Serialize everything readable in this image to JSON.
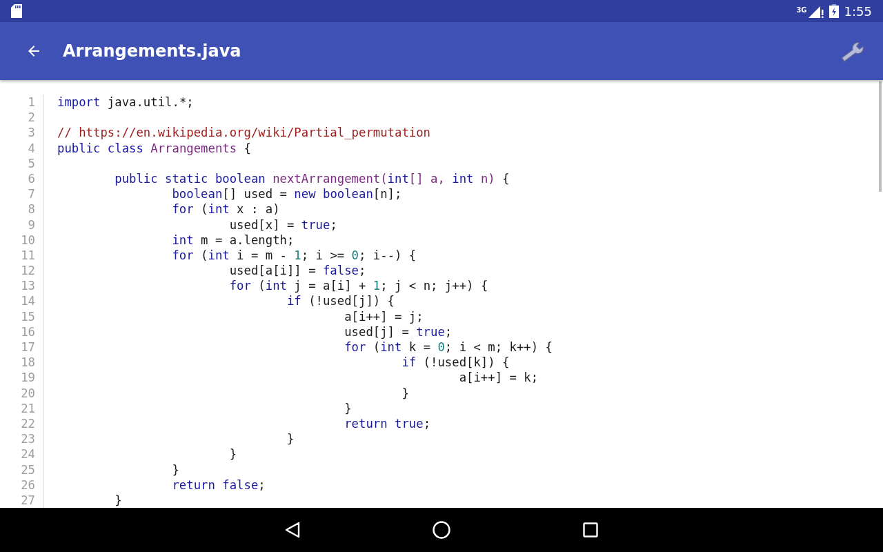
{
  "status_bar": {
    "network": "3G",
    "time": "1:55"
  },
  "app_bar": {
    "title": "Arrangements.java"
  },
  "editor": {
    "lines": [
      {
        "number": "1",
        "tokens": [
          {
            "kind": "keyword",
            "text": "import"
          },
          {
            "kind": "plain",
            "text": " java.util.*;"
          }
        ]
      },
      {
        "number": "2"
      },
      {
        "number": "3",
        "tokens": [
          {
            "kind": "comment",
            "text": "// https://en.wikipedia.org/wiki/Partial_permutation"
          }
        ]
      },
      {
        "number": "4",
        "tokens": [
          {
            "kind": "keyword",
            "text": "public class"
          },
          {
            "kind": "name",
            "text": " Arrangements"
          },
          {
            "kind": "plain",
            "text": " {"
          }
        ]
      },
      {
        "number": "5"
      },
      {
        "number": "6",
        "tokens": [
          {
            "kind": "keyword",
            "text": "\tpublic static boolean"
          },
          {
            "kind": "name",
            "text": " nextArrangement("
          },
          {
            "kind": "keyword",
            "text": "int"
          },
          {
            "kind": "name",
            "text": "[] a, "
          },
          {
            "kind": "keyword",
            "text": "int"
          },
          {
            "kind": "name",
            "text": " n)"
          },
          {
            "kind": "plain",
            "text": " {"
          }
        ]
      },
      {
        "number": "7",
        "tokens": [
          {
            "kind": "keyword",
            "text": "\t\tboolean"
          },
          {
            "kind": "plain",
            "text": "[] used = "
          },
          {
            "kind": "keyword",
            "text": "new boolean"
          },
          {
            "kind": "plain",
            "text": "[n];"
          }
        ]
      },
      {
        "number": "8",
        "tokens": [
          {
            "kind": "keyword",
            "text": "\t\tfor"
          },
          {
            "kind": "plain",
            "text": " ("
          },
          {
            "kind": "keyword",
            "text": "int"
          },
          {
            "kind": "plain",
            "text": " x : a)"
          }
        ]
      },
      {
        "number": "9",
        "tokens": [
          {
            "kind": "plain",
            "text": "\t\t\tused[x] = "
          },
          {
            "kind": "keyword",
            "text": "true"
          },
          {
            "kind": "plain",
            "text": ";"
          }
        ]
      },
      {
        "number": "10",
        "tokens": [
          {
            "kind": "keyword",
            "text": "\t\tint"
          },
          {
            "kind": "plain",
            "text": " m = a.length;"
          }
        ]
      },
      {
        "number": "11",
        "tokens": [
          {
            "kind": "keyword",
            "text": "\t\tfor"
          },
          {
            "kind": "plain",
            "text": " ("
          },
          {
            "kind": "keyword",
            "text": "int"
          },
          {
            "kind": "plain",
            "text": " i = m - "
          },
          {
            "kind": "number",
            "text": "1"
          },
          {
            "kind": "plain",
            "text": "; i >= "
          },
          {
            "kind": "number",
            "text": "0"
          },
          {
            "kind": "plain",
            "text": "; i--) {"
          }
        ]
      },
      {
        "number": "12",
        "tokens": [
          {
            "kind": "plain",
            "text": "\t\t\tused[a[i]] = "
          },
          {
            "kind": "keyword",
            "text": "false"
          },
          {
            "kind": "plain",
            "text": ";"
          }
        ]
      },
      {
        "number": "13",
        "tokens": [
          {
            "kind": "keyword",
            "text": "\t\t\tfor"
          },
          {
            "kind": "plain",
            "text": " ("
          },
          {
            "kind": "keyword",
            "text": "int"
          },
          {
            "kind": "plain",
            "text": " j = a[i] + "
          },
          {
            "kind": "number",
            "text": "1"
          },
          {
            "kind": "plain",
            "text": "; j < n; j++) {"
          }
        ]
      },
      {
        "number": "14",
        "tokens": [
          {
            "kind": "keyword",
            "text": "\t\t\t\tif"
          },
          {
            "kind": "plain",
            "text": " (!used[j]) {"
          }
        ]
      },
      {
        "number": "15",
        "tokens": [
          {
            "kind": "plain",
            "text": "\t\t\t\t\ta[i++] = j;"
          }
        ]
      },
      {
        "number": "16",
        "tokens": [
          {
            "kind": "plain",
            "text": "\t\t\t\t\tused[j] = "
          },
          {
            "kind": "keyword",
            "text": "true"
          },
          {
            "kind": "plain",
            "text": ";"
          }
        ]
      },
      {
        "number": "17",
        "tokens": [
          {
            "kind": "keyword",
            "text": "\t\t\t\t\tfor"
          },
          {
            "kind": "plain",
            "text": " ("
          },
          {
            "kind": "keyword",
            "text": "int"
          },
          {
            "kind": "plain",
            "text": " k = "
          },
          {
            "kind": "number",
            "text": "0"
          },
          {
            "kind": "plain",
            "text": "; i < m; k++) {"
          }
        ]
      },
      {
        "number": "18",
        "tokens": [
          {
            "kind": "keyword",
            "text": "\t\t\t\t\t\tif"
          },
          {
            "kind": "plain",
            "text": " (!used[k]) {"
          }
        ]
      },
      {
        "number": "19",
        "tokens": [
          {
            "kind": "plain",
            "text": "\t\t\t\t\t\t\ta[i++] = k;"
          }
        ]
      },
      {
        "number": "20",
        "tokens": [
          {
            "kind": "plain",
            "text": "\t\t\t\t\t\t}"
          }
        ]
      },
      {
        "number": "21",
        "tokens": [
          {
            "kind": "plain",
            "text": "\t\t\t\t\t}"
          }
        ]
      },
      {
        "number": "22",
        "tokens": [
          {
            "kind": "keyword",
            "text": "\t\t\t\t\treturn true"
          },
          {
            "kind": "plain",
            "text": ";"
          }
        ]
      },
      {
        "number": "23",
        "tokens": [
          {
            "kind": "plain",
            "text": "\t\t\t\t}"
          }
        ]
      },
      {
        "number": "24",
        "tokens": [
          {
            "kind": "plain",
            "text": "\t\t\t}"
          }
        ]
      },
      {
        "number": "25",
        "tokens": [
          {
            "kind": "plain",
            "text": "\t\t}"
          }
        ]
      },
      {
        "number": "26",
        "tokens": [
          {
            "kind": "keyword",
            "text": "\t\treturn false"
          },
          {
            "kind": "plain",
            "text": ";"
          }
        ]
      },
      {
        "number": "27",
        "tokens": [
          {
            "kind": "plain",
            "text": "\t}"
          }
        ]
      }
    ]
  }
}
